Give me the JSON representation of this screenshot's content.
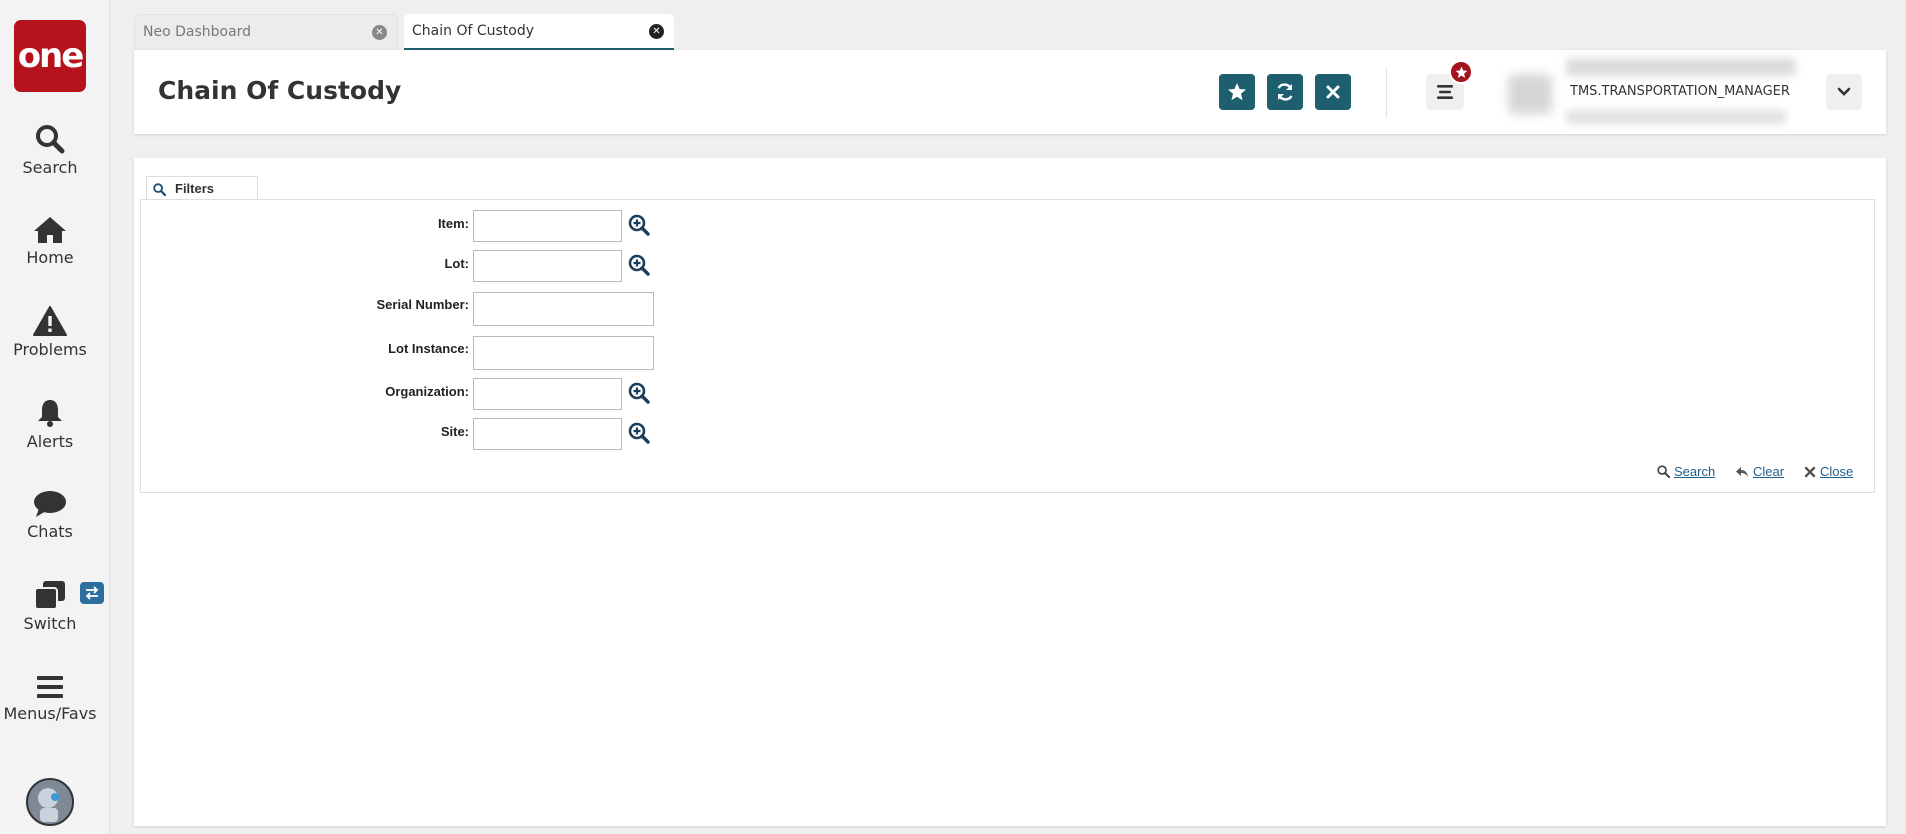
{
  "logo": {
    "text": "one"
  },
  "nav": {
    "items": [
      {
        "label": "Search",
        "icon": "search-icon"
      },
      {
        "label": "Home",
        "icon": "home-icon"
      },
      {
        "label": "Problems",
        "icon": "warning-icon"
      },
      {
        "label": "Alerts",
        "icon": "bell-icon"
      },
      {
        "label": "Chats",
        "icon": "chat-icon"
      },
      {
        "label": "Switch",
        "icon": "switch-icon"
      },
      {
        "label": "Menus/Favs",
        "icon": "menu-icon"
      }
    ]
  },
  "tabs": [
    {
      "label": "Neo Dashboard",
      "active": false
    },
    {
      "label": "Chain Of Custody",
      "active": true
    }
  ],
  "header": {
    "title": "Chain Of Custody",
    "user_name": "TMS.TRANSPORTATION_MANAGER"
  },
  "filters": {
    "tab_label": "Filters",
    "fields": [
      {
        "label": "Item:",
        "value": "",
        "lookup": true
      },
      {
        "label": "Lot:",
        "value": "",
        "lookup": true
      },
      {
        "label": "Serial Number:",
        "value": "",
        "lookup": false
      },
      {
        "label": "Lot Instance:",
        "value": "",
        "lookup": false
      },
      {
        "label": "Organization:",
        "value": "",
        "lookup": true
      },
      {
        "label": "Site:",
        "value": "",
        "lookup": true
      }
    ],
    "actions": {
      "search": "Search",
      "clear": "Clear",
      "close": "Close"
    }
  },
  "colors": {
    "brand": "#b5121b",
    "accent": "#1d5f6e",
    "link": "#1d5f8e",
    "badge": "#a3151d",
    "switch_badge": "#2c6e9e"
  }
}
